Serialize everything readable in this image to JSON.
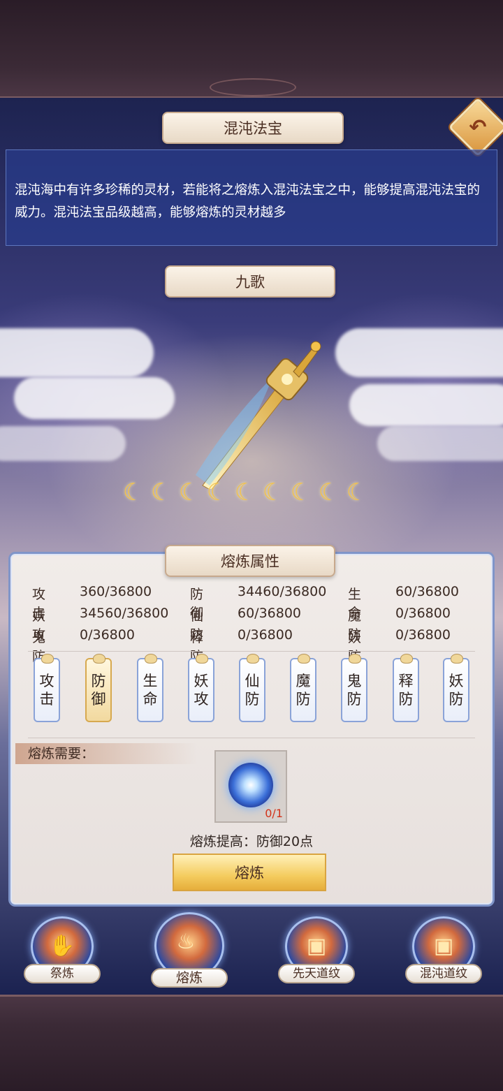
{
  "header": {
    "title": "混沌法宝",
    "back_icon": "back-arrow-icon"
  },
  "description": "混沌海中有许多珍稀的灵材，若能将之熔炼入混沌法宝之中，能够提高混沌法宝的威力。混沌法宝品级越高，能够熔炼的灵材越多",
  "treasure": {
    "name": "九歌",
    "star_count": 9,
    "star_icon": "crescent-moon-icon"
  },
  "attributes": {
    "title": "熔炼属性",
    "rows": [
      [
        {
          "label": "攻击",
          "value": "360/36800"
        },
        {
          "label": "防御",
          "value": "34460/36800"
        },
        {
          "label": "生命",
          "value": "60/36800"
        }
      ],
      [
        {
          "label": "妖攻",
          "value": "34560/36800"
        },
        {
          "label": "仙防",
          "value": "60/36800"
        },
        {
          "label": "魔防",
          "value": "0/36800"
        }
      ],
      [
        {
          "label": "鬼防",
          "value": "0/36800"
        },
        {
          "label": "释防",
          "value": "0/36800"
        },
        {
          "label": "妖防",
          "value": "0/36800"
        }
      ]
    ]
  },
  "tabs": [
    {
      "top": "攻",
      "bottom": "击"
    },
    {
      "top": "防",
      "bottom": "御"
    },
    {
      "top": "生",
      "bottom": "命"
    },
    {
      "top": "妖",
      "bottom": "攻"
    },
    {
      "top": "仙",
      "bottom": "防"
    },
    {
      "top": "魔",
      "bottom": "防"
    },
    {
      "top": "鬼",
      "bottom": "防"
    },
    {
      "top": "释",
      "bottom": "防"
    },
    {
      "top": "妖",
      "bottom": "防"
    }
  ],
  "active_tab": 1,
  "requirement": {
    "label": "熔炼需要：",
    "item_icon": "blue-spirit-orb-icon",
    "count": "0/1"
  },
  "gain_text": "熔炼提高：防御20点",
  "smelt_button": "熔炼",
  "bottom_nav": [
    {
      "label": "祭炼",
      "icon": "hand-altar-icon"
    },
    {
      "label": "熔炼",
      "icon": "furnace-icon"
    },
    {
      "label": "先天道纹",
      "icon": "rune-stone-icon"
    },
    {
      "label": "混沌道纹",
      "icon": "rune-stone-icon"
    }
  ],
  "colors": {
    "accent_gold": "#f4cc5f",
    "panel_border": "#7f95c9",
    "count_red": "#d2321a"
  }
}
